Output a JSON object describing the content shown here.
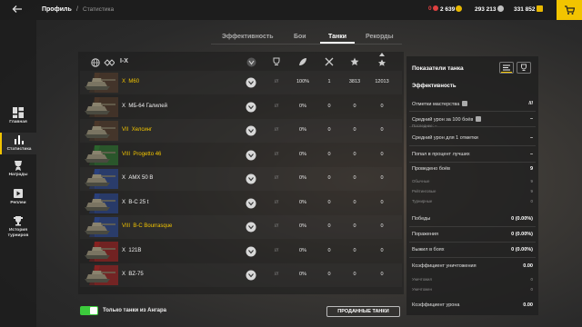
{
  "header": {
    "back_icon": "arrow-left-icon",
    "crumb_profile": "Профиль",
    "crumb_sep": "/",
    "crumb_stats": "Статистика",
    "currencies": [
      {
        "value": "0",
        "icon": "bonds-icon",
        "color": "#e04040"
      },
      {
        "value": "2 639",
        "icon": "gold-icon",
        "color": "#e8b800"
      },
      {
        "value": "293 213",
        "icon": "credits-icon",
        "color": "#c0c0c0"
      },
      {
        "value": "331 852",
        "icon": "free-xp-icon",
        "color": "#e8b800"
      }
    ]
  },
  "sidebar": {
    "items": [
      {
        "label": "Главная",
        "icon": "home-grid-icon"
      },
      {
        "label": "Статистика",
        "icon": "stats-bars-icon"
      },
      {
        "label": "Награды",
        "icon": "award-icon"
      },
      {
        "label": "Реплеи",
        "icon": "replay-icon"
      },
      {
        "label": "История турниров",
        "label2": "турниров",
        "label1": "История",
        "icon": "trophy-icon"
      }
    ]
  },
  "tabs": [
    {
      "label": "Эффективность"
    },
    {
      "label": "Бои"
    },
    {
      "label": "Танки"
    },
    {
      "label": "Рекорды"
    }
  ],
  "filters": {
    "tier_range": "I-X"
  },
  "columns": [
    "mastery",
    "mastery-count",
    "win-rate",
    "battles",
    "avg-damage",
    "total-damage"
  ],
  "tanks": [
    {
      "tier": "X",
      "name": "M60",
      "premium": true,
      "count": "///",
      "winrate": "100%",
      "battles": "1",
      "dmg": "3813",
      "total": "12013",
      "flag_color": "#5a3e2b"
    },
    {
      "tier": "X",
      "name": "MБ-64 Галилей",
      "premium": false,
      "count": "///",
      "winrate": "0%",
      "battles": "0",
      "dmg": "0",
      "total": "0",
      "flag_color": "#5a3e2b"
    },
    {
      "tier": "VII",
      "name": "Хелсинг",
      "premium": true,
      "count": "///",
      "winrate": "0%",
      "battles": "0",
      "dmg": "0",
      "total": "0",
      "flag_color": "#5a3e2b"
    },
    {
      "tier": "VIII",
      "name": "Progetto 46",
      "premium": true,
      "count": "///",
      "winrate": "0%",
      "battles": "0",
      "dmg": "0",
      "total": "0",
      "flag_color": "#2e7d32"
    },
    {
      "tier": "X",
      "name": "AMX 50 B",
      "premium": false,
      "count": "///",
      "winrate": "0%",
      "battles": "0",
      "dmg": "0",
      "total": "0",
      "flag_color": "#2a4aa0"
    },
    {
      "tier": "X",
      "name": "B-C 25 t",
      "premium": false,
      "count": "///",
      "winrate": "0%",
      "battles": "0",
      "dmg": "0",
      "total": "0",
      "flag_color": "#2a4aa0"
    },
    {
      "tier": "VIII",
      "name": "B-C Bourrasque",
      "premium": true,
      "count": "///",
      "winrate": "0%",
      "battles": "0",
      "dmg": "0",
      "total": "0",
      "flag_color": "#2a4aa0"
    },
    {
      "tier": "X",
      "name": "121B",
      "premium": false,
      "count": "///",
      "winrate": "0%",
      "battles": "0",
      "dmg": "0",
      "total": "0",
      "flag_color": "#b02020"
    },
    {
      "tier": "X",
      "name": "BZ-75",
      "premium": false,
      "count": "///",
      "winrate": "0%",
      "battles": "0",
      "dmg": "0",
      "total": "0",
      "flag_color": "#b02020"
    }
  ],
  "footer": {
    "toggle_label": "Только танки из Ангара",
    "sold_button": "ПРОДАННЫЕ ТАНКИ"
  },
  "right_panel": {
    "title": "Показатели танка",
    "section": "Эффективность",
    "rows": [
      {
        "label": "Отметки мастерства",
        "value": "///",
        "info": true
      },
      {
        "label": "Средний урон за 100 боёв",
        "value": "–",
        "info": true,
        "sub": "Последнее: –"
      },
      {
        "label": "Средний урон для 1 отметки",
        "value": "–"
      },
      {
        "label": "Попал в процент лучших",
        "value": "–"
      },
      {
        "label": "Проведено боёв",
        "value": "9"
      },
      {
        "label": "Обычные",
        "value": "9",
        "is_sub": true
      },
      {
        "label": "Рейтинговые",
        "value": "9",
        "is_sub": true
      },
      {
        "label": "Турнирные",
        "value": "0",
        "is_sub": true
      },
      {
        "label": "Победы",
        "value": "0 (0.00%)"
      },
      {
        "label": "Поражения",
        "value": "0 (0.00%)"
      },
      {
        "label": "Выжил в боях",
        "value": "0 (0.00%)"
      },
      {
        "label": "Коэффициент уничтожения",
        "value": "0.00"
      },
      {
        "label": "Уничтожил",
        "value": "0",
        "is_sub": true
      },
      {
        "label": "Уничтожен",
        "value": "0",
        "is_sub": true
      },
      {
        "label": "Коэффициент урона",
        "value": "0.00"
      }
    ]
  }
}
